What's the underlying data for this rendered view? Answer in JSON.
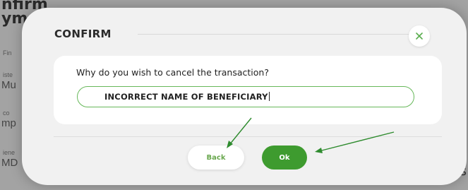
{
  "background": {
    "title_line1": "nfirm",
    "title_line2": "ym",
    "labels": [
      "Fin",
      "iste",
      "co",
      "iene"
    ],
    "values": [
      "Mu",
      "mp",
      "MD"
    ],
    "right_fragment": "s"
  },
  "modal": {
    "title": "CONFIRM",
    "close_icon": "close-x-icon",
    "question": "Why do you wish to cancel the transaction?",
    "reason_value": "INCORRECT NAME OF BENEFICIARY",
    "back_label": "Back",
    "ok_label": "Ok"
  },
  "colors": {
    "accent_green": "#3e9b2f",
    "input_border": "#67b85a",
    "back_text": "#6aa84f",
    "annotation_arrow": "#2e8b2e"
  }
}
